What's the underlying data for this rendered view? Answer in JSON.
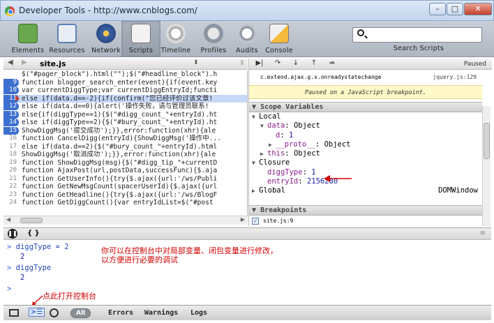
{
  "window": {
    "title": "Developer Tools - http://www.cnblogs.com/",
    "controls": [
      "–",
      "□",
      "✕"
    ]
  },
  "toolbar": {
    "tools": [
      {
        "label": "Elements",
        "icon": "elements-icon",
        "color": "#6aa84f"
      },
      {
        "label": "Resources",
        "icon": "resources-icon",
        "color": "#5b7fb8"
      },
      {
        "label": "Network",
        "icon": "network-icon",
        "color": "#3e63a5"
      },
      {
        "label": "Scripts",
        "icon": "scripts-icon",
        "color": "#d8d8d8",
        "active": true
      },
      {
        "label": "Timeline",
        "icon": "timeline-icon",
        "color": "#c9c9c9"
      },
      {
        "label": "Profiles",
        "icon": "profiles-icon",
        "color": "#b0b8c4"
      },
      {
        "label": "Audits",
        "icon": "audits-icon",
        "color": "#c2c7cf"
      },
      {
        "label": "Console",
        "icon": "console-icon",
        "color": "#c9463d"
      }
    ],
    "search_placeholder": "",
    "search_label": "Search Scripts"
  },
  "source": {
    "file": "site.js",
    "lines": [
      {
        "n": "",
        "text": "$(\"#pager_block\").html(\"\");$(\"#headline_block\").h"
      },
      {
        "n": "9",
        "text": "function blogger_search_enter(event){if(event.key",
        "bp": true
      },
      {
        "n": "10",
        "text": "var currentDiggType;var currentDiggEntryId;functi",
        "bp": true
      },
      {
        "n": "11",
        "text": "else if(data.d==-2){if(confirm(\"您已经评价过该文章!",
        "bp": true,
        "current": true
      },
      {
        "n": "12",
        "text": "else if(data.d==0){alert('操作失败，请与管理员联系!",
        "bp": true
      },
      {
        "n": "13",
        "text": "else{if(diggType==1){$(\"#digg_count_\"+entryId).ht",
        "bp": true
      },
      {
        "n": "14",
        "text": "else if(diggType==2){$(\"#bury_count_\"+entryId).ht",
        "bp": true
      },
      {
        "n": "15",
        "text": "ShowDiggMsg('提交成功');}},error:function(xhr){ale",
        "bp": true
      },
      {
        "n": "16",
        "text": "function CancelDigg(entryId){ShowDiggMsg('操作中...",
        "bp": false
      },
      {
        "n": "17",
        "text": "else if(data.d==2){$(\"#bury_count_\"+entryId).html",
        "bp": false
      },
      {
        "n": "18",
        "text": "ShowDiggMsg('取消成功');}},error:function(xhr){ale",
        "bp": false
      },
      {
        "n": "19",
        "text": "function ShowDiggMsg(msg){$(\"#digg_tip_\"+currentD",
        "bp": false
      },
      {
        "n": "20",
        "text": "function AjaxPost(url,postData,successFunc){$.aja",
        "bp": false
      },
      {
        "n": "21",
        "text": "function GetUserInfo(){try{$.ajax({url:'/ws/Publi",
        "bp": false
      },
      {
        "n": "22",
        "text": "function GetNewMsgCount(spacerUserId){$.ajax({url",
        "bp": false
      },
      {
        "n": "23",
        "text": "function GetHeadline(){try{$.ajax({url:'/ws/BlogF",
        "bp": false
      },
      {
        "n": "24",
        "text": "function GetDiggCount(){var entryIdList=$(\"#post",
        "bp": false
      }
    ]
  },
  "debugger": {
    "paused_label": "Paused",
    "call_frame": {
      "name": "c.extend.ajax.g.x.onreadystatechange",
      "location": "jquery.js:129"
    },
    "pause_message": "Paused on a JavaScript breakpoint.",
    "scope_header": "Scope Variables",
    "scope": [
      {
        "indent": 0,
        "tri": "▼",
        "key": "Local",
        "val": ""
      },
      {
        "indent": 1,
        "tri": "▼",
        "key": "data",
        "val": "Object"
      },
      {
        "indent": 2,
        "tri": "",
        "key": "d",
        "val": "1"
      },
      {
        "indent": 2,
        "tri": "▶",
        "key": "__proto__",
        "val": "Object"
      },
      {
        "indent": 1,
        "tri": "▶",
        "key": "this",
        "val": "Object"
      },
      {
        "indent": 0,
        "tri": "▼",
        "key": "Closure",
        "val": ""
      },
      {
        "indent": 1,
        "tri": "",
        "key": "diggType",
        "val": "1"
      },
      {
        "indent": 1,
        "tri": "",
        "key": "entryId",
        "val": "2156280"
      },
      {
        "indent": 0,
        "tri": "▶",
        "key": "Global",
        "val": "DOMWindow"
      }
    ],
    "breakpoints_header": "Breakpoints",
    "breakpoint": "site.js:9"
  },
  "console": {
    "tab_braces": "{ }",
    "entries": [
      {
        "prompt": ">",
        "input": "diggType = 2"
      },
      {
        "output": "2"
      },
      {
        "prompt": ">",
        "input": "diggType"
      },
      {
        "output": "2"
      },
      {
        "prompt": ">",
        "input": ""
      }
    ],
    "annotation_1": "你可以在控制台中对局部变量、闭包变量进行修改，",
    "annotation_2": "以方便进行必要的调试",
    "annotation_3": "点此打开控制台"
  },
  "statusbar": {
    "filters": [
      "All",
      "Errors",
      "Warnings",
      "Logs"
    ]
  },
  "colors": {
    "annotation": "#d20000",
    "breakpoint": "#3d6fcf",
    "current_line": "#c7d7f8"
  }
}
